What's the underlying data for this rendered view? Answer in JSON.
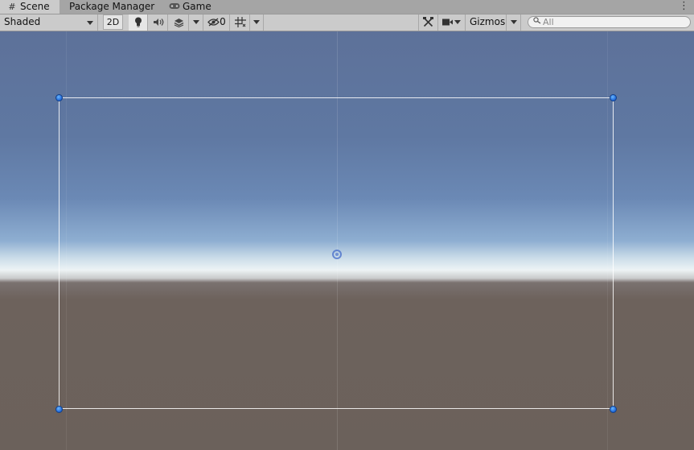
{
  "tabs": [
    {
      "label": "Scene",
      "icon": "hash-icon",
      "active": true
    },
    {
      "label": "Package Manager",
      "icon": null,
      "active": false
    },
    {
      "label": "Game",
      "icon": "gamepad-icon",
      "active": false
    }
  ],
  "toolbar": {
    "draw_mode": "Shaded",
    "mode_2d": "2D",
    "hidden_count": "0",
    "gizmos": "Gizmos",
    "search_placeholder": "All"
  },
  "icons": {
    "lighting": "lightbulb-icon",
    "audio": "speaker-icon",
    "effects": "layers-icon",
    "hidden": "eye-slash-icon",
    "grid": "grid-icon",
    "tools": "tools-icon",
    "camera": "camera-icon",
    "search": "search-icon"
  },
  "colors": {
    "sky_top": "#5d7199",
    "horizon": "#edf3f5",
    "ground": "#6b615b",
    "handle": "#1c64d6"
  }
}
